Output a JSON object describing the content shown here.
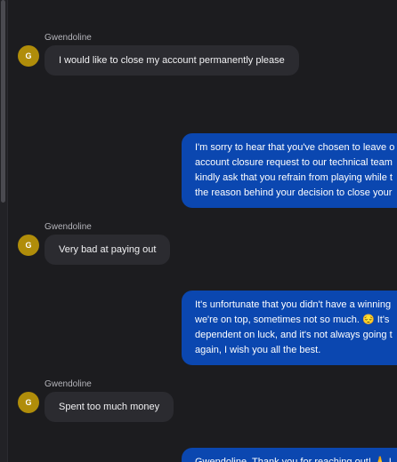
{
  "conversation": {
    "messages": [
      {
        "sender": "Gwendoline",
        "avatar_initial": "G",
        "text": "I would like to close my account permanently please"
      },
      {
        "lines": [
          "I'm sorry to hear that you've chosen to leave o",
          "account closure request to our technical team",
          "kindly ask that you refrain from playing while t",
          "the reason behind your decision to close your"
        ]
      },
      {
        "sender": "Gwendoline",
        "avatar_initial": "G",
        "text": "Very bad at paying out"
      },
      {
        "lines": [
          "It's unfortunate that you didn't have a winning",
          "we're on top, sometimes not so much. 😔 It's",
          "dependent on luck, and it's not always going t",
          "again, I wish you all the best."
        ]
      },
      {
        "sender": "Gwendoline",
        "avatar_initial": "G",
        "text": "Spent too much money"
      },
      {
        "lines": [
          "Gwendoline, Thank you for reaching out! 🙏 I"
        ]
      }
    ]
  }
}
